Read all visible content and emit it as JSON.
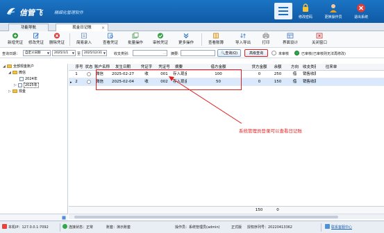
{
  "header": {
    "brand": "信管飞",
    "tagline": "精细化管理软件",
    "buttons": [
      {
        "label": "修改密码"
      },
      {
        "label": "更换操作员"
      },
      {
        "label": "退出系统"
      }
    ]
  },
  "tabs": [
    {
      "label": "功能导航"
    },
    {
      "label": "现金日记账",
      "close": "×"
    }
  ],
  "toolbar": {
    "items": [
      {
        "label": "新增凭证",
        "icon": "add-icon",
        "color": "#2f9a3c"
      },
      {
        "label": "修改凭证",
        "icon": "edit-icon",
        "color": "#2a6fc4"
      },
      {
        "label": "删除凭证",
        "icon": "delete-icon",
        "color": "#d83a3a"
      },
      {
        "label": "简易录入",
        "icon": "form-icon",
        "color": "#6b8cc7"
      },
      {
        "label": "查看凭证",
        "icon": "view-icon",
        "color": "#3c7fd0"
      },
      {
        "label": "批量操作",
        "icon": "batch-icon",
        "color": "#4f9a55"
      },
      {
        "label": "审核凭证",
        "icon": "check-icon",
        "color": "#3aa04a"
      },
      {
        "label": "更多操作",
        "icon": "more-icon",
        "color": "#2a6fc4"
      },
      {
        "label": "查看账簿",
        "icon": "ledger-icon",
        "color": "#c98a2a"
      },
      {
        "label": "导入导出",
        "icon": "import-export-icon",
        "color": "#5a8fd0"
      },
      {
        "label": "打印",
        "icon": "print-icon",
        "color": "#666666"
      },
      {
        "label": "界面设计",
        "icon": "design-icon",
        "color": "#4f7fc0"
      },
      {
        "label": "关闭窗口",
        "icon": "close-window-icon",
        "color": "#c94040"
      }
    ]
  },
  "query": {
    "date_label": "查询日期：",
    "date_mode": "自定义日期",
    "date_from": "2025/1/1",
    "to_label": "至",
    "date_to": "2025/12/31",
    "type_label": "收支类别:",
    "type_value": "",
    "summary_label": "摘要:",
    "summary_value": "",
    "query_button": "查询(Q)",
    "advanced_button": "高级查询",
    "legend_unaudited": "未审核",
    "legend_audited": "已审核(已审核则无法再修改)"
  },
  "tree": {
    "root": "全部现金账户",
    "account": "微信",
    "years": [
      "2024年",
      "2025年"
    ],
    "other": "现金"
  },
  "grid": {
    "columns": [
      "序号",
      "状态",
      "账户名称",
      "发生日期",
      "凭证字",
      "凭证号",
      "摘要",
      "借方金额",
      "贷方金额",
      "余额",
      "方向",
      "收支类别",
      "往来单"
    ],
    "rows": [
      {
        "seq": "1",
        "account": "微信",
        "date": "2025-02-27",
        "word": "收",
        "number": "001",
        "summary": "存入现金",
        "debit": "100",
        "credit": "0",
        "balance": "250",
        "dir": "借",
        "category": "销售收款"
      },
      {
        "seq": "2",
        "account": "微信",
        "date": "2025-02-04",
        "word": "收",
        "number": "002",
        "summary": "存入现金",
        "debit": "50",
        "credit": "0",
        "balance": "150",
        "dir": "借",
        "category": "销售收款"
      }
    ],
    "footer_debit": "150",
    "footer_credit": "0"
  },
  "annotation": "系统管理员登录可以查看日记账",
  "status": {
    "ip": "本机IP：127.0.0.1:7092",
    "conn": "连接状态：正常",
    "account_set": "账套：演示账套",
    "operator": "操作员：系统管理员(admin)",
    "edition": "正式版",
    "license": "授权序列号：20220413362",
    "link": "联系客服中心"
  }
}
